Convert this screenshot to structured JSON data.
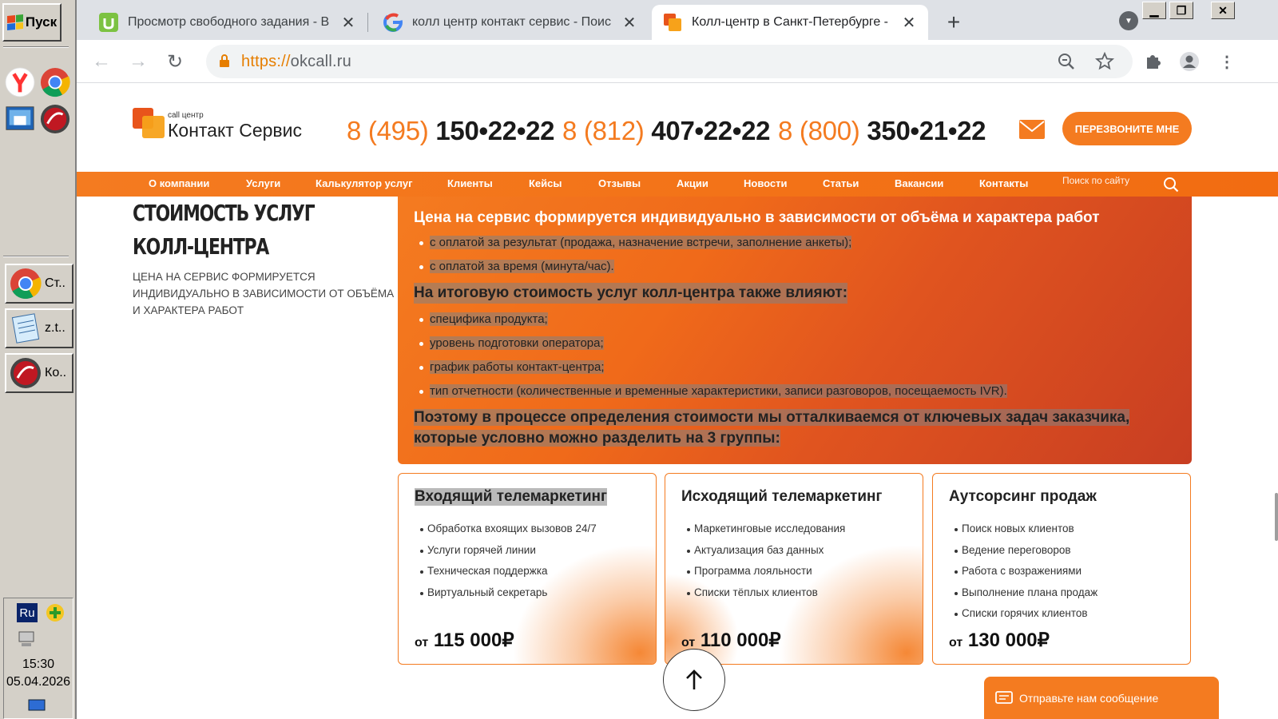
{
  "taskbar": {
    "start_label": "Пуск",
    "tasks": [
      {
        "label": "Ст..",
        "icon": "chrome-icon"
      },
      {
        "label": "z.t..",
        "icon": "notepad-icon"
      },
      {
        "label": "Ко..",
        "icon": "antivirus-icon"
      }
    ],
    "lang": "Ru",
    "time": "15:30",
    "date": "05.04.2026"
  },
  "browser": {
    "tabs": [
      {
        "title": "Просмотр свободного задания - В",
        "icon": "uniq-icon",
        "active": false
      },
      {
        "title": "колл центр контакт сервис - Поиск",
        "icon": "google-icon",
        "active": false
      },
      {
        "title": "Колл-центр в Санкт-Петербурге - У",
        "icon": "okcall-icon",
        "active": true
      }
    ],
    "url_scheme": "https://",
    "url_host": "okcall.ru"
  },
  "site": {
    "logo_small": "call центр",
    "logo_name": "Контакт Сервис",
    "phones": [
      {
        "code": "8 (495)",
        "number": "150•22•22"
      },
      {
        "code": "8 (812)",
        "number": "407•22•22"
      },
      {
        "code": "8 (800)",
        "number": "350•21•22"
      }
    ],
    "callback_label": "Перезвоните мне",
    "nav": [
      "О компании",
      "Услуги",
      "Калькулятор услуг",
      "Клиенты",
      "Кейсы",
      "Отзывы",
      "Акции",
      "Новости",
      "Статьи",
      "Вакансии",
      "Контакты"
    ],
    "search_placeholder": "Поиск по сайту",
    "accent_color": "#f47b20"
  },
  "content": {
    "title_line1": "СТОИМОСТЬ УСЛУГ",
    "title_line2": "КОЛЛ-ЦЕНТРА",
    "subtitle": "ЦЕНА НА СЕРВИС ФОРМИРУЕТСЯ ИНДИВИДУАЛЬНО В ЗАВИСИМОСТИ ОТ ОБЪЁМА И ХАРАКТЕРА РАБОТ",
    "box_heading": "Цена на сервис формируется индивидуально в зависимости от объёма и характера работ",
    "payment_list": [
      "с оплатой за результат (продажа, назначение встречи, заполнение анкеты);",
      "с оплатой за время (минута/час)."
    ],
    "factors_heading": "На итоговую стоимость услуг колл-центра также влияют:",
    "factors_list": [
      "специфика продукта;",
      "уровень подготовки оператора;",
      "график работы контакт-центра;",
      "тип отчетности (количественные и временные характеристики, записи разговоров, посещаемость IVR)."
    ],
    "final_text": "Поэтому в процессе определения стоимости мы отталкиваемся от ключевых задач заказчика, которые условно можно разделить на 3 группы:",
    "cards": [
      {
        "title": "Входящий телемаркетинг",
        "items": [
          "Обработка вхоящих вызовов 24/7",
          "Услуги горячей линии",
          "Техническая поддержка",
          "Виртуальный секретарь"
        ],
        "price_prefix": "от",
        "price": "115 000₽"
      },
      {
        "title": "Исходящий телемаркетинг",
        "items": [
          "Маркетинговые исследования",
          "Актуализация баз данных",
          "Программа лояльности",
          "Списки тёплых клиентов"
        ],
        "price_prefix": "от",
        "price": "110 000₽"
      },
      {
        "title": "Аутсорсинг продаж",
        "items": [
          "Поиск новых клиентов",
          "Ведение переговоров",
          "Работа с возражениями",
          "Выполнение плана продаж",
          "Списки горячих клиентов"
        ],
        "price_prefix": "от",
        "price": "130 000₽"
      }
    ],
    "message_widget": "Отправьте нам сообщение"
  }
}
